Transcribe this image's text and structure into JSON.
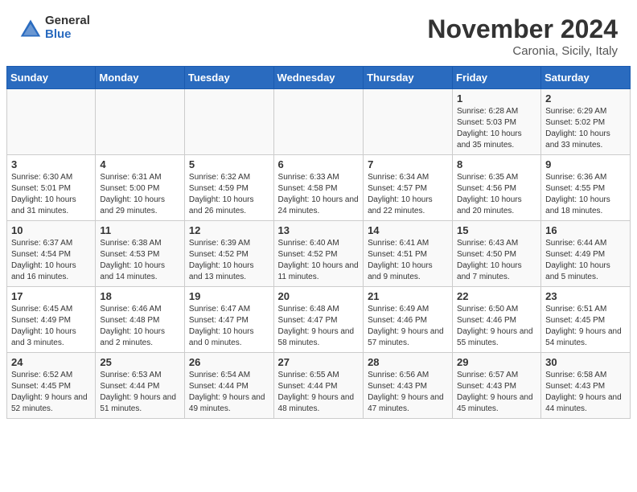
{
  "logo": {
    "general": "General",
    "blue": "Blue"
  },
  "title": "November 2024",
  "location": "Caronia, Sicily, Italy",
  "days_header": [
    "Sunday",
    "Monday",
    "Tuesday",
    "Wednesday",
    "Thursday",
    "Friday",
    "Saturday"
  ],
  "weeks": [
    [
      {
        "day": "",
        "info": ""
      },
      {
        "day": "",
        "info": ""
      },
      {
        "day": "",
        "info": ""
      },
      {
        "day": "",
        "info": ""
      },
      {
        "day": "",
        "info": ""
      },
      {
        "day": "1",
        "info": "Sunrise: 6:28 AM\nSunset: 5:03 PM\nDaylight: 10 hours and 35 minutes."
      },
      {
        "day": "2",
        "info": "Sunrise: 6:29 AM\nSunset: 5:02 PM\nDaylight: 10 hours and 33 minutes."
      }
    ],
    [
      {
        "day": "3",
        "info": "Sunrise: 6:30 AM\nSunset: 5:01 PM\nDaylight: 10 hours and 31 minutes."
      },
      {
        "day": "4",
        "info": "Sunrise: 6:31 AM\nSunset: 5:00 PM\nDaylight: 10 hours and 29 minutes."
      },
      {
        "day": "5",
        "info": "Sunrise: 6:32 AM\nSunset: 4:59 PM\nDaylight: 10 hours and 26 minutes."
      },
      {
        "day": "6",
        "info": "Sunrise: 6:33 AM\nSunset: 4:58 PM\nDaylight: 10 hours and 24 minutes."
      },
      {
        "day": "7",
        "info": "Sunrise: 6:34 AM\nSunset: 4:57 PM\nDaylight: 10 hours and 22 minutes."
      },
      {
        "day": "8",
        "info": "Sunrise: 6:35 AM\nSunset: 4:56 PM\nDaylight: 10 hours and 20 minutes."
      },
      {
        "day": "9",
        "info": "Sunrise: 6:36 AM\nSunset: 4:55 PM\nDaylight: 10 hours and 18 minutes."
      }
    ],
    [
      {
        "day": "10",
        "info": "Sunrise: 6:37 AM\nSunset: 4:54 PM\nDaylight: 10 hours and 16 minutes."
      },
      {
        "day": "11",
        "info": "Sunrise: 6:38 AM\nSunset: 4:53 PM\nDaylight: 10 hours and 14 minutes."
      },
      {
        "day": "12",
        "info": "Sunrise: 6:39 AM\nSunset: 4:52 PM\nDaylight: 10 hours and 13 minutes."
      },
      {
        "day": "13",
        "info": "Sunrise: 6:40 AM\nSunset: 4:52 PM\nDaylight: 10 hours and 11 minutes."
      },
      {
        "day": "14",
        "info": "Sunrise: 6:41 AM\nSunset: 4:51 PM\nDaylight: 10 hours and 9 minutes."
      },
      {
        "day": "15",
        "info": "Sunrise: 6:43 AM\nSunset: 4:50 PM\nDaylight: 10 hours and 7 minutes."
      },
      {
        "day": "16",
        "info": "Sunrise: 6:44 AM\nSunset: 4:49 PM\nDaylight: 10 hours and 5 minutes."
      }
    ],
    [
      {
        "day": "17",
        "info": "Sunrise: 6:45 AM\nSunset: 4:49 PM\nDaylight: 10 hours and 3 minutes."
      },
      {
        "day": "18",
        "info": "Sunrise: 6:46 AM\nSunset: 4:48 PM\nDaylight: 10 hours and 2 minutes."
      },
      {
        "day": "19",
        "info": "Sunrise: 6:47 AM\nSunset: 4:47 PM\nDaylight: 10 hours and 0 minutes."
      },
      {
        "day": "20",
        "info": "Sunrise: 6:48 AM\nSunset: 4:47 PM\nDaylight: 9 hours and 58 minutes."
      },
      {
        "day": "21",
        "info": "Sunrise: 6:49 AM\nSunset: 4:46 PM\nDaylight: 9 hours and 57 minutes."
      },
      {
        "day": "22",
        "info": "Sunrise: 6:50 AM\nSunset: 4:46 PM\nDaylight: 9 hours and 55 minutes."
      },
      {
        "day": "23",
        "info": "Sunrise: 6:51 AM\nSunset: 4:45 PM\nDaylight: 9 hours and 54 minutes."
      }
    ],
    [
      {
        "day": "24",
        "info": "Sunrise: 6:52 AM\nSunset: 4:45 PM\nDaylight: 9 hours and 52 minutes."
      },
      {
        "day": "25",
        "info": "Sunrise: 6:53 AM\nSunset: 4:44 PM\nDaylight: 9 hours and 51 minutes."
      },
      {
        "day": "26",
        "info": "Sunrise: 6:54 AM\nSunset: 4:44 PM\nDaylight: 9 hours and 49 minutes."
      },
      {
        "day": "27",
        "info": "Sunrise: 6:55 AM\nSunset: 4:44 PM\nDaylight: 9 hours and 48 minutes."
      },
      {
        "day": "28",
        "info": "Sunrise: 6:56 AM\nSunset: 4:43 PM\nDaylight: 9 hours and 47 minutes."
      },
      {
        "day": "29",
        "info": "Sunrise: 6:57 AM\nSunset: 4:43 PM\nDaylight: 9 hours and 45 minutes."
      },
      {
        "day": "30",
        "info": "Sunrise: 6:58 AM\nSunset: 4:43 PM\nDaylight: 9 hours and 44 minutes."
      }
    ]
  ]
}
